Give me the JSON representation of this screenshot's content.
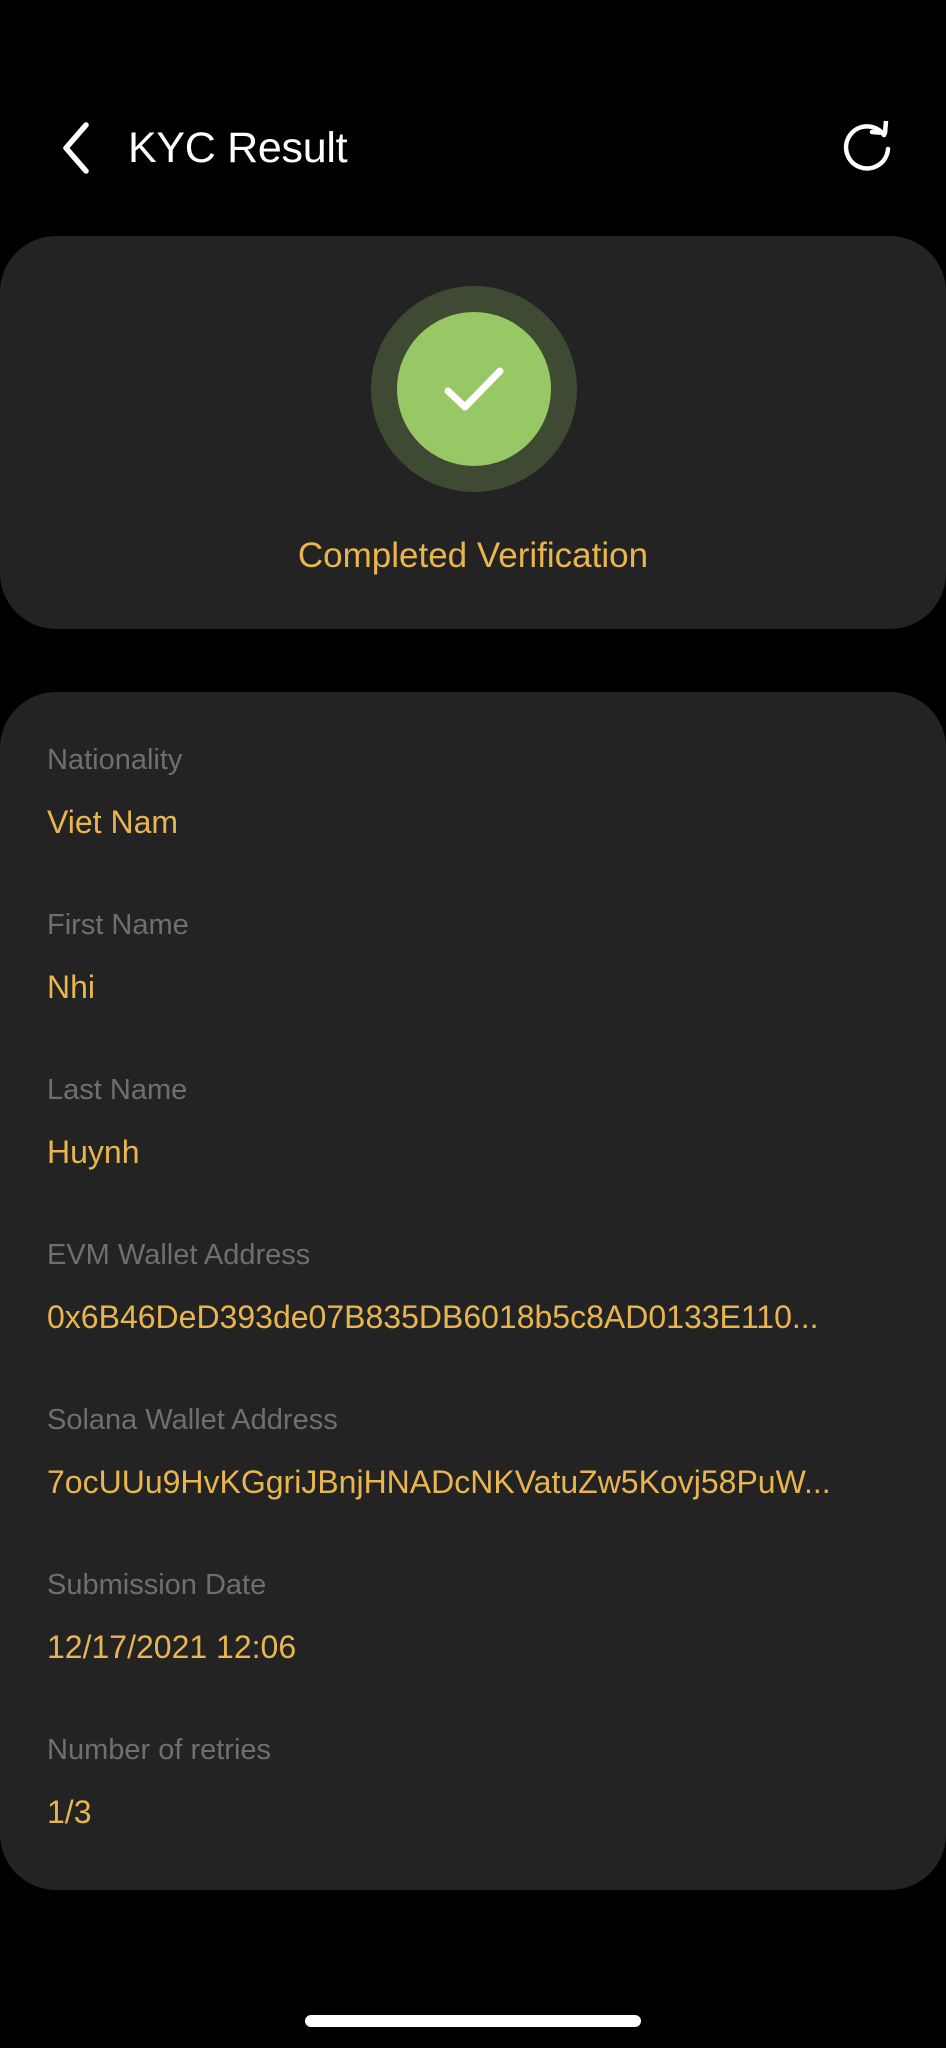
{
  "header": {
    "title": "KYC Result",
    "back_icon": "chevron-left-icon",
    "refresh_icon": "refresh-icon"
  },
  "status": {
    "icon": "check-icon",
    "text": "Completed Verification",
    "colors": {
      "accent": "#e8b54f",
      "success": "#98c765",
      "success_ring": "#3e4a32"
    }
  },
  "fields": [
    {
      "label": "Nationality",
      "value": "Viet Nam"
    },
    {
      "label": "First Name",
      "value": "Nhi"
    },
    {
      "label": "Last Name",
      "value": "Huynh"
    },
    {
      "label": "EVM Wallet Address",
      "value": "0x6B46DeD393de07B835DB6018b5c8AD0133E110..."
    },
    {
      "label": "Solana Wallet Address",
      "value": "7ocUUu9HvKGgriJBnjHNADcNKVatuZw5Kovj58PuW..."
    },
    {
      "label": "Submission Date",
      "value": "12/17/2021 12:06"
    },
    {
      "label": "Number of retries",
      "value": "1/3"
    }
  ]
}
